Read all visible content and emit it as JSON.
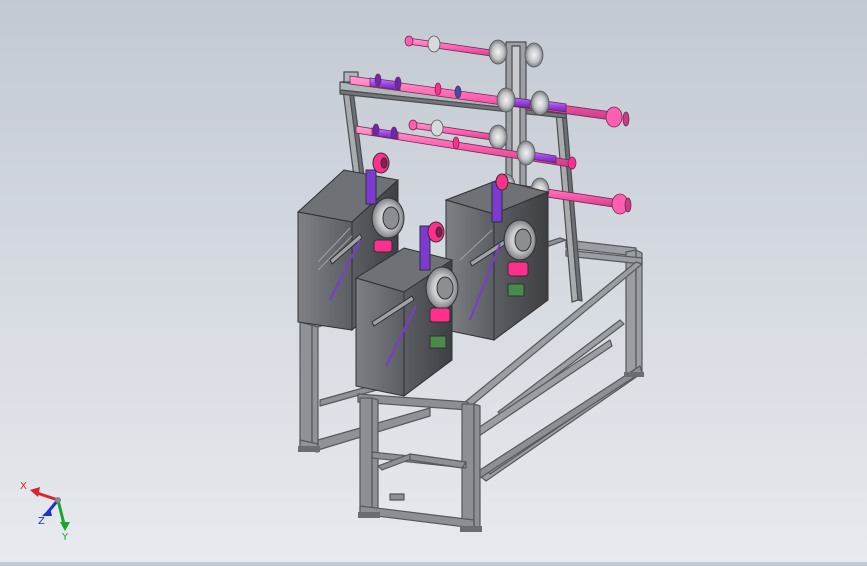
{
  "viewport": {
    "background_top": "#c3c9d2",
    "background_bottom": "#e7eaee"
  },
  "colors": {
    "frame": "#8c8f93",
    "frame_dark": "#55585c",
    "box": "#4a4c50",
    "box_light": "#7a7c80",
    "pink_shaft": "#ff5fae",
    "purple_shaft": "#a14cf0",
    "bracket_pink": "#ff2f8c",
    "wheel": "#c9cbce"
  },
  "triad": {
    "x_label": "X",
    "y_label": "Y",
    "z_label": "Z",
    "x_color": "#d7262d",
    "y_color": "#1fa22f",
    "z_color": "#2032c8"
  }
}
